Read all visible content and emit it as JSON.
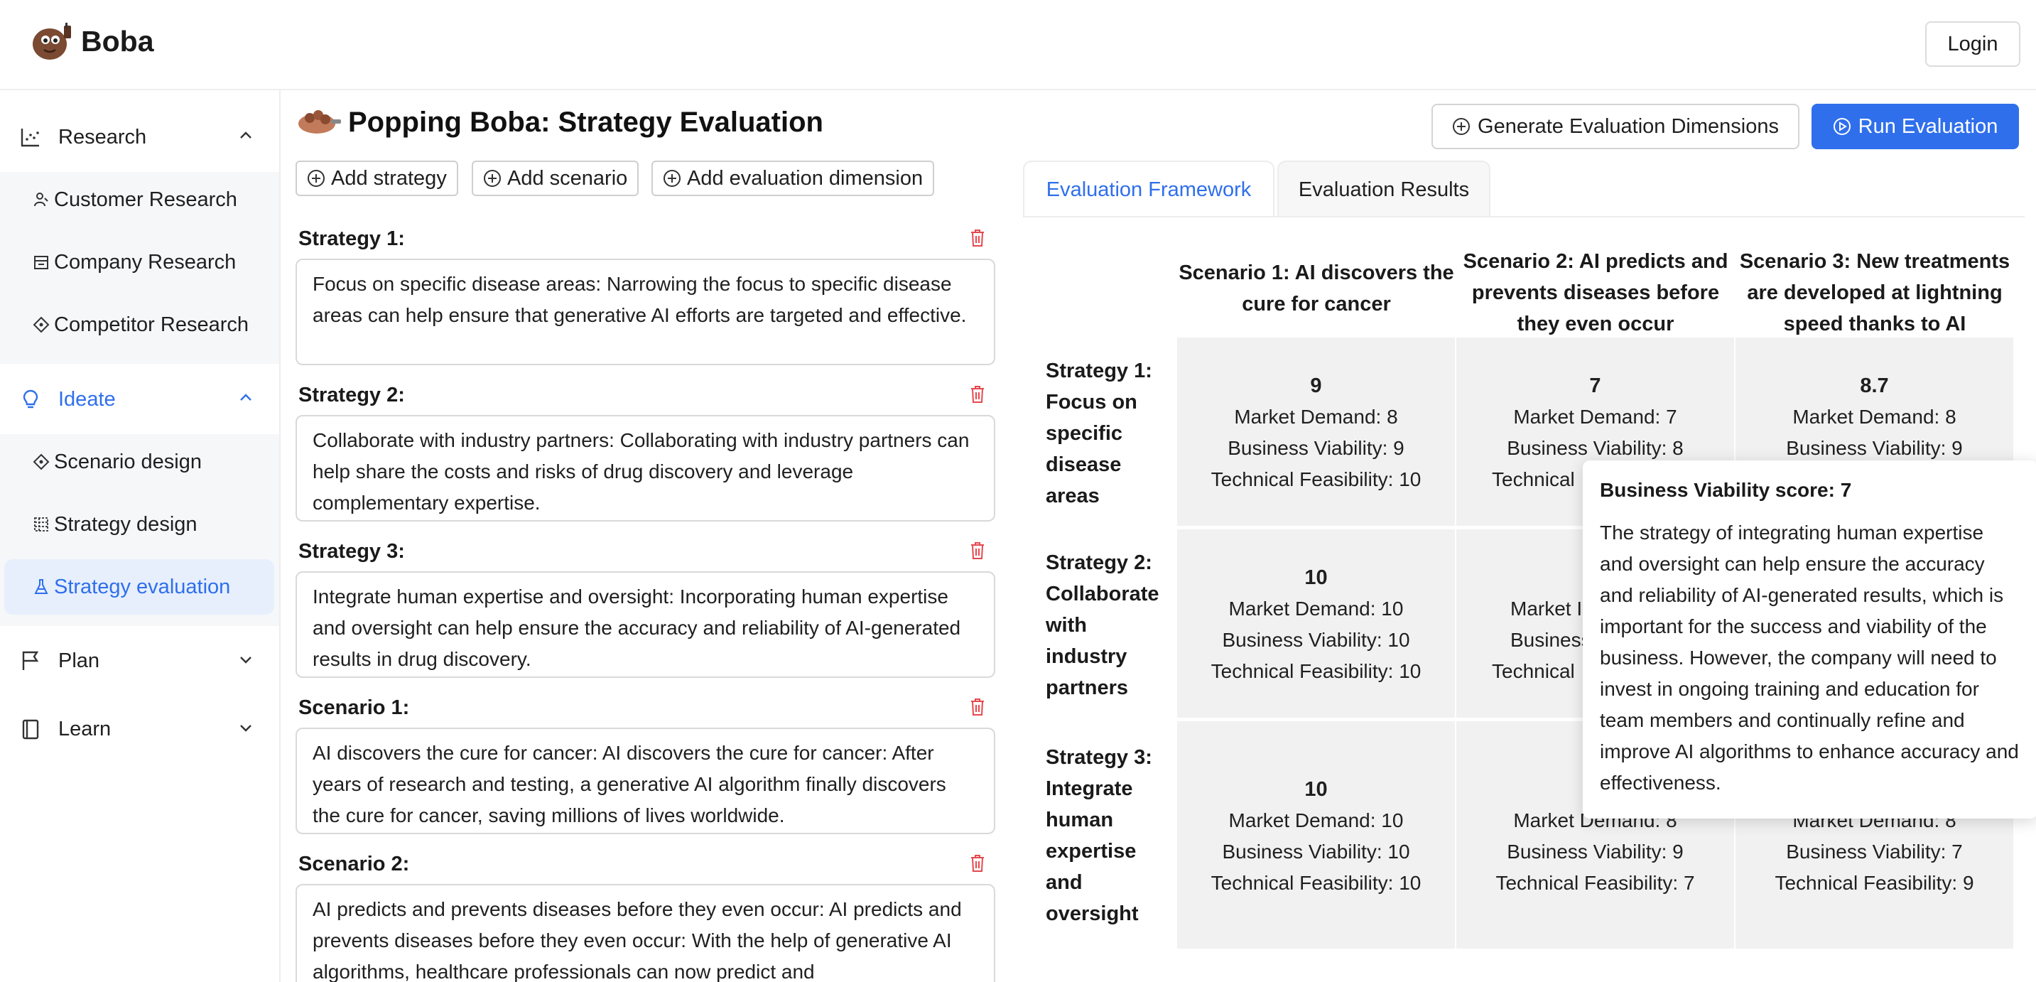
{
  "app": {
    "name": "Boba",
    "login_label": "Login"
  },
  "sidebar": {
    "groups": [
      {
        "label": "Research",
        "items": [
          "Customer Research",
          "Company Research",
          "Competitor Research"
        ]
      },
      {
        "label": "Ideate",
        "items": [
          "Scenario design",
          "Strategy design",
          "Strategy evaluation"
        ],
        "selected": "Strategy evaluation"
      },
      {
        "label": "Plan",
        "items": []
      },
      {
        "label": "Learn",
        "items": []
      }
    ]
  },
  "page": {
    "title": "Popping Boba: Strategy Evaluation",
    "toolbar": {
      "add_strategy": "Add strategy",
      "add_scenario": "Add scenario",
      "add_dimension": "Add evaluation dimension"
    },
    "generate_label": "Generate Evaluation Dimensions",
    "run_label": "Run Evaluation"
  },
  "cards": [
    {
      "label": "Strategy 1:",
      "text": "Focus on specific disease areas: Narrowing the focus to specific disease areas can help ensure that generative AI efforts are targeted and effective."
    },
    {
      "label": "Strategy 2:",
      "text": "Collaborate with industry partners: Collaborating with industry partners can help share the costs and risks of drug discovery and leverage complementary expertise."
    },
    {
      "label": "Strategy 3:",
      "text": "Integrate human expertise and oversight: Incorporating human expertise and oversight can help ensure the accuracy and reliability of AI-generated results in drug discovery."
    },
    {
      "label": "Scenario 1:",
      "text": "AI discovers the cure for cancer: AI discovers the cure for cancer: After years of research and testing, a generative AI algorithm finally discovers the cure for cancer, saving millions of lives worldwide."
    },
    {
      "label": "Scenario 2:",
      "text": "AI predicts and prevents diseases before they even occur: AI predicts and prevents diseases before they even occur: With the help of generative AI algorithms, healthcare professionals can now predict and"
    }
  ],
  "tabs": {
    "framework": "Evaluation Framework",
    "results": "Evaluation Results"
  },
  "matrix": {
    "columns": [
      "Scenario 1: AI discovers the cure for cancer",
      "Scenario 2: AI predicts and prevents diseases before they even occur",
      "Scenario 3: New treatments are developed at lightning speed thanks to AI"
    ],
    "rows": [
      "Strategy 1: Focus on specific disease areas",
      "Strategy 2: Collaborate with industry partners",
      "Strategy 3: Integrate human expertise and oversight"
    ],
    "cells": [
      [
        {
          "score": "9",
          "lines": [
            "Market Demand: 8",
            "Business Viability: 9",
            "Technical Feasibility: 10"
          ]
        },
        {
          "score": "7",
          "lines": [
            "Market Demand: 7",
            "Business Viability: 8",
            "Technical"
          ]
        },
        {
          "score": "8.7",
          "lines": [
            "Market Demand: 8",
            "Business Viability: 9"
          ]
        }
      ],
      [
        {
          "score": "10",
          "lines": [
            "Market Demand: 10",
            "Business Viability: 10",
            "Technical Feasibility: 10"
          ]
        },
        {
          "score": "",
          "lines": [
            "Market I",
            "Business",
            "Technical"
          ]
        },
        {
          "score": "",
          "lines": []
        }
      ],
      [
        {
          "score": "10",
          "lines": [
            "Market Demand: 10",
            "Business Viability: 10",
            "Technical Feasibility: 10"
          ]
        },
        {
          "score": "",
          "lines": [
            "Market Demand: 8",
            "Business Viability: 9",
            "Technical Feasibility: 7"
          ]
        },
        {
          "score": "",
          "lines": [
            "Market Demand: 8",
            "Business Viability: 7",
            "Technical Feasibility: 9"
          ]
        }
      ]
    ]
  },
  "tooltip": {
    "title": "Business Viability score: 7",
    "body": "The strategy of integrating human expertise and oversight can help ensure the accuracy and reliability of AI-generated results, which is important for the success and viability of the business. However, the company will need to invest in ongoing training and education for team members and continually refine and improve AI algorithms to enhance accuracy and effectiveness."
  },
  "colors": {
    "accent": "#2f6fec",
    "delete": "#e5484d",
    "cell_bg": "#f1f1f1"
  }
}
